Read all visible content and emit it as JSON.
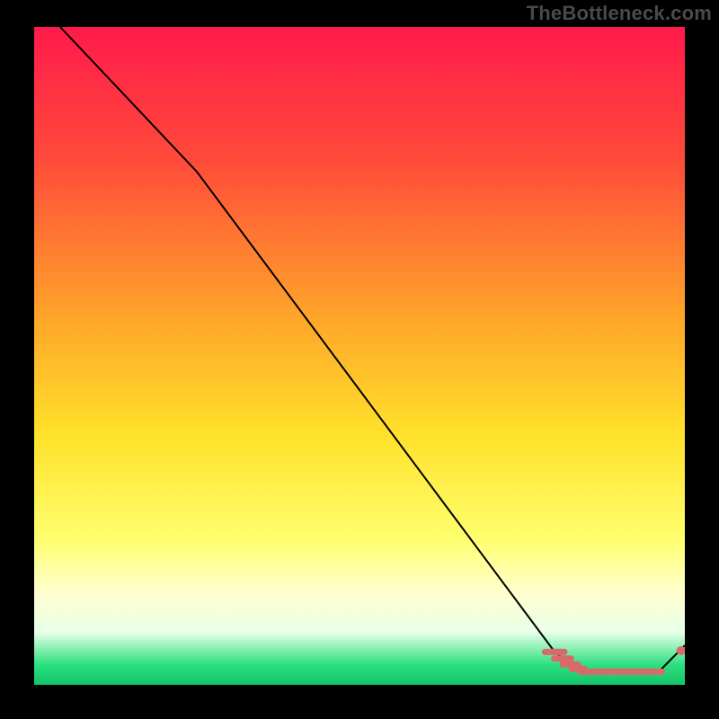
{
  "watermark": "TheBottleneck.com",
  "chart_data": {
    "type": "line",
    "title": "",
    "xlabel": "",
    "ylabel": "",
    "xlim": [
      0,
      100
    ],
    "ylim": [
      0,
      100
    ],
    "gradient_stops": [
      {
        "offset": 0,
        "color": "#ff1a4b"
      },
      {
        "offset": 20,
        "color": "#ff4a3a"
      },
      {
        "offset": 45,
        "color": "#ffa829"
      },
      {
        "offset": 62,
        "color": "#ffe12a"
      },
      {
        "offset": 78,
        "color": "#ffff70"
      },
      {
        "offset": 86,
        "color": "#ffffd0"
      },
      {
        "offset": 92,
        "color": "#e8ffe8"
      },
      {
        "offset": 97,
        "color": "#2be07e"
      },
      {
        "offset": 100,
        "color": "#12c46a"
      }
    ],
    "series": [
      {
        "name": "curve",
        "type": "line",
        "color": "#000000",
        "x": [
          4,
          25,
          80,
          84,
          96,
          100
        ],
        "y": [
          100,
          78,
          5,
          2,
          2,
          6
        ]
      },
      {
        "name": "dash-segment",
        "type": "dash-points",
        "color": "#d96a6a",
        "points": [
          {
            "x": 80.0,
            "y": 5.0,
            "len": 3.0
          },
          {
            "x": 81.2,
            "y": 4.0,
            "len": 2.6
          },
          {
            "x": 82.4,
            "y": 3.1,
            "len": 2.4
          },
          {
            "x": 83.6,
            "y": 2.4,
            "len": 2.0
          },
          {
            "x": 85.2,
            "y": 2.0,
            "len": 2.6
          },
          {
            "x": 87.5,
            "y": 2.0,
            "len": 2.2
          },
          {
            "x": 89.2,
            "y": 2.0,
            "len": 1.2
          },
          {
            "x": 90.6,
            "y": 2.0,
            "len": 2.2
          },
          {
            "x": 92.8,
            "y": 2.0,
            "len": 2.0
          },
          {
            "x": 94.6,
            "y": 2.0,
            "len": 1.2
          },
          {
            "x": 96.0,
            "y": 2.0,
            "len": 1.0
          }
        ]
      },
      {
        "name": "end-dot",
        "type": "scatter",
        "color": "#d96a6a",
        "x": [
          99.4
        ],
        "y": [
          5.2
        ]
      }
    ]
  }
}
